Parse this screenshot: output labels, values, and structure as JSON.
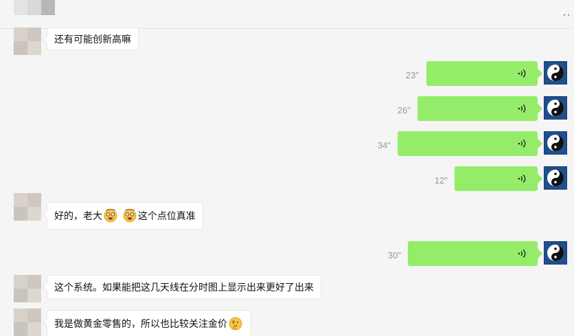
{
  "header": {
    "more_icon": "more-icon",
    "more_label": "··"
  },
  "messages": [
    {
      "type": "text_in",
      "text": "还有可能创新高嘛"
    },
    {
      "type": "voice_out",
      "duration": "23\""
    },
    {
      "type": "voice_out",
      "duration": "26\""
    },
    {
      "type": "voice_out",
      "duration": "34\""
    },
    {
      "type": "voice_out",
      "duration": "12\""
    },
    {
      "type": "text_in",
      "parts": [
        "好的，老大",
        "这个点位真准"
      ],
      "emoji": "dizzy-face-emoji"
    },
    {
      "type": "voice_out",
      "duration": "30\""
    },
    {
      "type": "text_in",
      "text": "这个系统。如果能把这几天线在分时图上显示出来更好了出来"
    },
    {
      "type": "text_in",
      "text": "我是做黄金零售的，所以也比较关注金价",
      "emoji": "thinking-face-emoji"
    }
  ],
  "colors": {
    "voice_bubble": "#95ec69",
    "incoming_bubble": "#ffffff",
    "background": "#f5f5f5",
    "self_avatar": "#1f4f8f"
  }
}
